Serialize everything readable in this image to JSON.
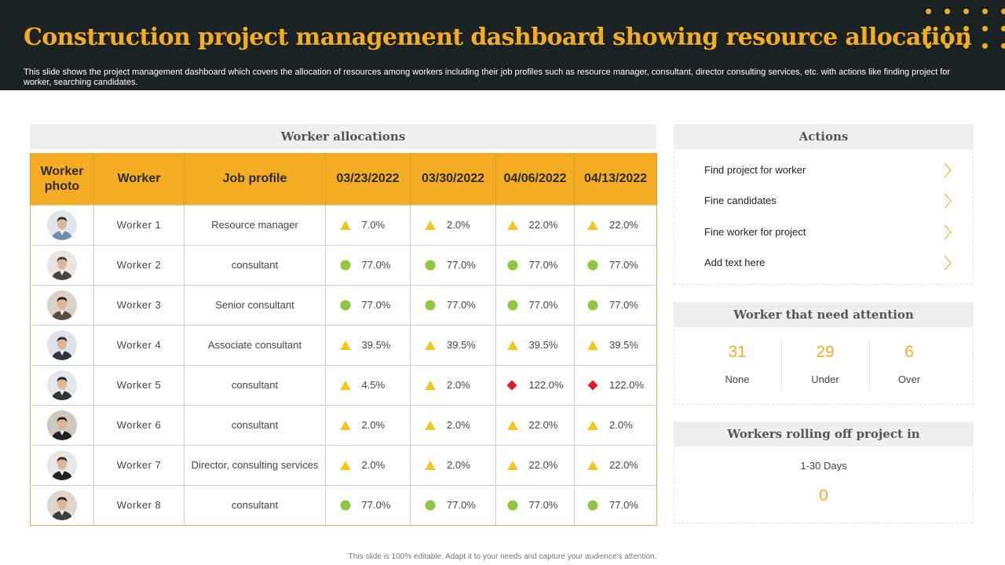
{
  "header": {
    "title": "Construction project management dashboard showing resource allocation",
    "subtitle": "This slide shows the project management dashboard which covers the allocation of resources among workers including their job profiles such as resource manager, consultant, director consulting services, etc. with actions like finding project for worker, searching candidates."
  },
  "colors": {
    "accent": "#f4ad22",
    "header_bg": "#1b2224",
    "status_ok": "#8dc63f",
    "status_warn": "#f5c518",
    "status_over": "#e31b23"
  },
  "allocations": {
    "title": "Worker allocations",
    "columns": [
      "Worker photo",
      "Worker",
      "Job profile",
      "03/23/2022",
      "03/30/2022",
      "04/06/2022",
      "04/13/2022"
    ],
    "rows": [
      {
        "worker": "Worker  1",
        "profile": "Resource manager",
        "cells": [
          {
            "status": "triangle",
            "value": "7.0%"
          },
          {
            "status": "triangle",
            "value": "2.0%"
          },
          {
            "status": "triangle",
            "value": "22.0%"
          },
          {
            "status": "triangle",
            "value": "22.0%"
          }
        ]
      },
      {
        "worker": "Worker  2",
        "profile": "consultant",
        "cells": [
          {
            "status": "circle",
            "value": "77.0%"
          },
          {
            "status": "circle",
            "value": "77.0%"
          },
          {
            "status": "circle",
            "value": "77.0%"
          },
          {
            "status": "circle",
            "value": "77.0%"
          }
        ]
      },
      {
        "worker": "Worker  3",
        "profile": "Senior consultant",
        "cells": [
          {
            "status": "circle",
            "value": "77.0%"
          },
          {
            "status": "circle",
            "value": "77.0%"
          },
          {
            "status": "circle",
            "value": "77.0%"
          },
          {
            "status": "circle",
            "value": "77.0%"
          }
        ]
      },
      {
        "worker": "Worker  4",
        "profile": "Associate consultant",
        "cells": [
          {
            "status": "triangle",
            "value": "39.5%"
          },
          {
            "status": "triangle",
            "value": "39.5%"
          },
          {
            "status": "triangle",
            "value": "39.5%"
          },
          {
            "status": "triangle",
            "value": "39.5%"
          }
        ]
      },
      {
        "worker": "Worker 5",
        "profile": "consultant",
        "cells": [
          {
            "status": "triangle",
            "value": "4.5%"
          },
          {
            "status": "triangle",
            "value": "2.0%"
          },
          {
            "status": "diamond",
            "value": "122.0%"
          },
          {
            "status": "diamond",
            "value": "122.0%"
          }
        ]
      },
      {
        "worker": "Worker 6",
        "profile": "consultant",
        "cells": [
          {
            "status": "triangle",
            "value": "2.0%"
          },
          {
            "status": "triangle",
            "value": "2.0%"
          },
          {
            "status": "triangle",
            "value": "22.0%"
          },
          {
            "status": "triangle",
            "value": "2.0%"
          }
        ]
      },
      {
        "worker": "Worker 7",
        "profile": "Director, consulting services",
        "cells": [
          {
            "status": "triangle",
            "value": "2.0%"
          },
          {
            "status": "triangle",
            "value": "2.0%"
          },
          {
            "status": "triangle",
            "value": "22.0%"
          },
          {
            "status": "triangle",
            "value": "22.0%"
          }
        ]
      },
      {
        "worker": "Worker 8",
        "profile": "consultant",
        "cells": [
          {
            "status": "circle",
            "value": "77.0%"
          },
          {
            "status": "circle",
            "value": "77.0%"
          },
          {
            "status": "circle",
            "value": "77.0%"
          },
          {
            "status": "circle",
            "value": "77.0%"
          }
        ]
      }
    ]
  },
  "actions": {
    "title": "Actions",
    "items": [
      {
        "label": "Find project for worker",
        "icon": "chevron-right-icon"
      },
      {
        "label": "Fine candidates",
        "icon": "chevron-right-icon"
      },
      {
        "label": "Fine worker for project",
        "icon": "chevron-right-icon"
      },
      {
        "label": "Add text here",
        "icon": "chevron-right-icon"
      }
    ]
  },
  "attention": {
    "title": "Worker that need attention",
    "stats": [
      {
        "value": "31",
        "label": "None"
      },
      {
        "value": "29",
        "label": "Under"
      },
      {
        "value": "6",
        "label": "Over"
      }
    ]
  },
  "rolling_off": {
    "title": "Workers rolling off project in",
    "label": "1-30 Days",
    "value": "0"
  },
  "footer": {
    "text": "This slide is 100% editable. Adapt it to your needs and capture your audience's attention."
  }
}
